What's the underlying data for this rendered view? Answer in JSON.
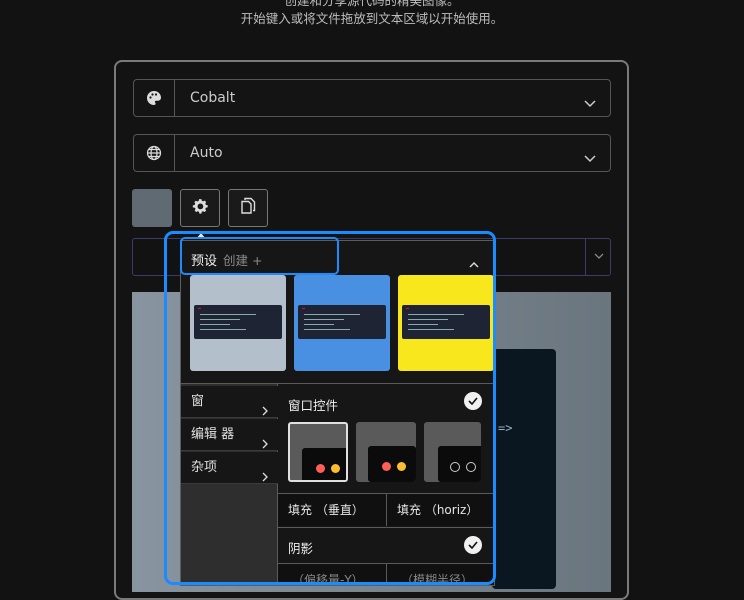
{
  "hint": {
    "line1": "创建和分享源代码的精美图像。",
    "line2": "开始键入或将文件拖放到文本区域以开始使用。"
  },
  "theme_select": {
    "icon": "palette-icon",
    "value": "Cobalt"
  },
  "language_select": {
    "icon": "globe-icon",
    "value": "Auto"
  },
  "toolbar": {
    "settings_icon": "gear-icon",
    "copy_icon": "copy-icon"
  },
  "settings_panel": {
    "presets_label": "预设",
    "create_label": "创建 +",
    "presets": [
      {
        "name": "preset-1",
        "bg": "#b4bfcc"
      },
      {
        "name": "preset-2",
        "bg": "#4a90e2"
      },
      {
        "name": "preset-3",
        "bg": "#f8e71c"
      }
    ],
    "menu": [
      {
        "label": "窗"
      },
      {
        "label": "编辑 器"
      },
      {
        "label": "杂项"
      }
    ],
    "window_controls_label": "窗口控件",
    "padding_vertical_label": "填充 （垂直）",
    "padding_horizontal_label": "填充 （horiz）",
    "shadow_label": "阴影",
    "offset_y_placeholder": "（偏移量-Y）",
    "blur_radius_placeholder": "（模糊半径）"
  },
  "editor_preview": {
    "arrow_text": "=>"
  },
  "colors": {
    "accent": "#1a8cff",
    "theme_swatch": "#5f6a73"
  }
}
